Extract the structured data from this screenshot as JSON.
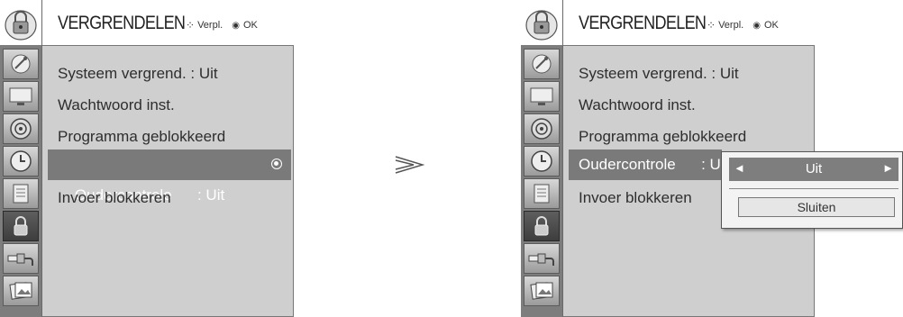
{
  "title": "VERGRENDELEN",
  "hint": {
    "move_label": "Verpl.",
    "ok_label": "OK"
  },
  "menu_items": [
    "Systeem vergrend. : Uit",
    "Wachtwoord inst.",
    "Programma geblokkeerd",
    "Oudercontrole      : Uit",
    "Invoer blokkeren"
  ],
  "right_truncated_item": "Oudercontrole      : U",
  "right_item3_partial": "Programma geblokkeerd",
  "popup": {
    "value": "Uit",
    "close_label": "Sluiten"
  },
  "sidebar_icons": [
    "satellite-icon",
    "tv-screen-icon",
    "speaker-icon",
    "clock-icon",
    "document-icon",
    "lock-icon",
    "cable-plug-icon",
    "photos-icon"
  ],
  "selected_icon": "lock-icon"
}
